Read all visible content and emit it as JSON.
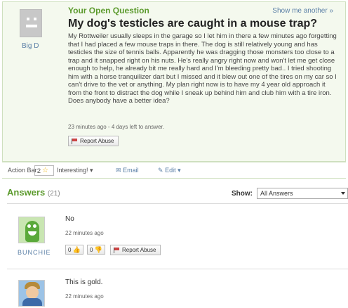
{
  "question": {
    "label": "Your Open Question",
    "show_another": "Show me another »",
    "asker_name": "Big D",
    "title": "My dog's testicles are caught in a mouse trap?",
    "body": "My Rottweiler usually sleeps in the garage so I let him in there a few minutes ago forgetting that I had placed a few mouse traps in there. The dog is still relatively young and has testicles the size of tennis balls. Apparently he was dragging those monsters too close to a trap and it snapped right on his nuts. He's really angry right now and won't let me get close enough to help, he already bit me really hard and I'm bleeding pretty bad.. I tried shooting him with a horse tranquilizer dart but I missed and it blew out one of the tires on my car so I can't drive to the vet or anything. My plan right now is to have my 4 year old approach it from the front to distract the dog while I sneak up behind him and club him with a tire iron. Does anybody have a better idea?",
    "meta": "23 minutes ago - 4 days left to answer.",
    "report_label": "Report Abuse"
  },
  "action_bar": {
    "label": "Action Bar:",
    "star_count": "2",
    "interesting": "Interesting! ▾",
    "email": "Email",
    "edit": "Edit ▾"
  },
  "answers": {
    "title": "Answers",
    "count": "(21)",
    "show_label": "Show:",
    "show_value": "All Answers",
    "items": [
      {
        "text": "No",
        "time": "22 minutes ago",
        "author": "BUNCHIE",
        "up": "0",
        "down": "0",
        "report_label": "Report Abuse"
      },
      {
        "text": "This is gold.",
        "time": "22 minutes ago"
      }
    ]
  },
  "colors": {
    "accent_green": "#5b9a2c",
    "link_blue": "#5a7fa6",
    "question_bg": "#f4f9ee"
  }
}
